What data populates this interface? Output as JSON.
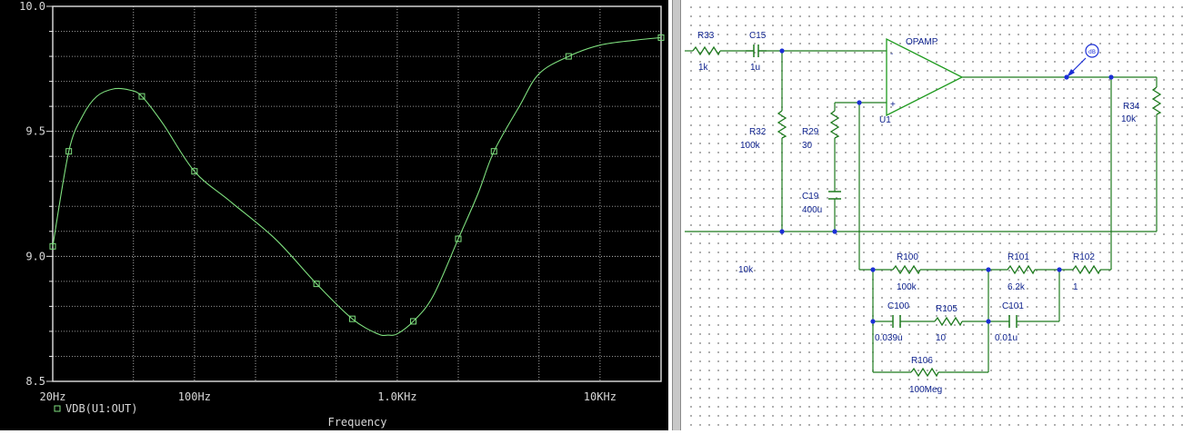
{
  "chart_data": {
    "type": "line",
    "xscale": "log",
    "xlim": [
      20,
      20000
    ],
    "ylim": [
      8.5,
      10.0
    ],
    "yticks": [
      "10.0",
      "9.5",
      "9.0",
      "8.5"
    ],
    "ytick_values": [
      10.0,
      9.5,
      9.0,
      8.5
    ],
    "xticks": [
      "20Hz",
      "100Hz",
      "1.0KHz",
      "10KHz"
    ],
    "xtick_values": [
      20,
      100,
      1000,
      10000
    ],
    "xlabel": "Frequency",
    "ylabel": "",
    "grid": true,
    "legend_position": "bottom-left",
    "colors": {
      "background": "#000000",
      "trace": "#7fe07f",
      "grid": "#d0d0d0",
      "text": "#d8d8d8"
    },
    "series": [
      {
        "name": "VDB(U1:OUT)",
        "x": [
          20,
          24,
          28,
          33,
          40,
          48,
          55,
          70,
          100,
          150,
          250,
          400,
          600,
          800,
          900,
          1000,
          1200,
          1500,
          2000,
          2500,
          3000,
          4000,
          5000,
          7000,
          10000,
          15000,
          20000
        ],
        "y": [
          9.04,
          9.42,
          9.56,
          9.64,
          9.67,
          9.665,
          9.64,
          9.53,
          9.34,
          9.22,
          9.07,
          8.89,
          8.75,
          8.69,
          8.685,
          8.69,
          8.74,
          8.84,
          9.07,
          9.25,
          9.42,
          9.6,
          9.73,
          9.8,
          9.845,
          9.865,
          9.875
        ]
      }
    ]
  },
  "schematic": {
    "components": [
      {
        "id": "R33",
        "value": "1k"
      },
      {
        "id": "C15",
        "value": "1u"
      },
      {
        "id": "R32",
        "value": "100k"
      },
      {
        "id": "R29",
        "value": "30"
      },
      {
        "id": "C19",
        "value": "400u"
      },
      {
        "id": "R34",
        "value": "10k"
      },
      {
        "id": "R100",
        "value": "100k"
      },
      {
        "id": "R101",
        "value": "6.2k"
      },
      {
        "id": "R102",
        "value": "1"
      },
      {
        "id": "C100",
        "value": "0.039u"
      },
      {
        "id": "R105",
        "value": "10"
      },
      {
        "id": "C101",
        "value": "0.01u"
      },
      {
        "id": "R106",
        "value": "100Meg"
      }
    ],
    "opamp": {
      "name": "OPAMP",
      "ref": "U1",
      "minus": "-",
      "plus": "+"
    },
    "probe_label": "dB",
    "stray_label": "10k",
    "colors": {
      "wire": "#1e7a1e",
      "resistor": "#1e7a1e",
      "node": "#1b2fd6",
      "text": "#0b1f8c",
      "opamp": "#1e9a1e"
    }
  }
}
